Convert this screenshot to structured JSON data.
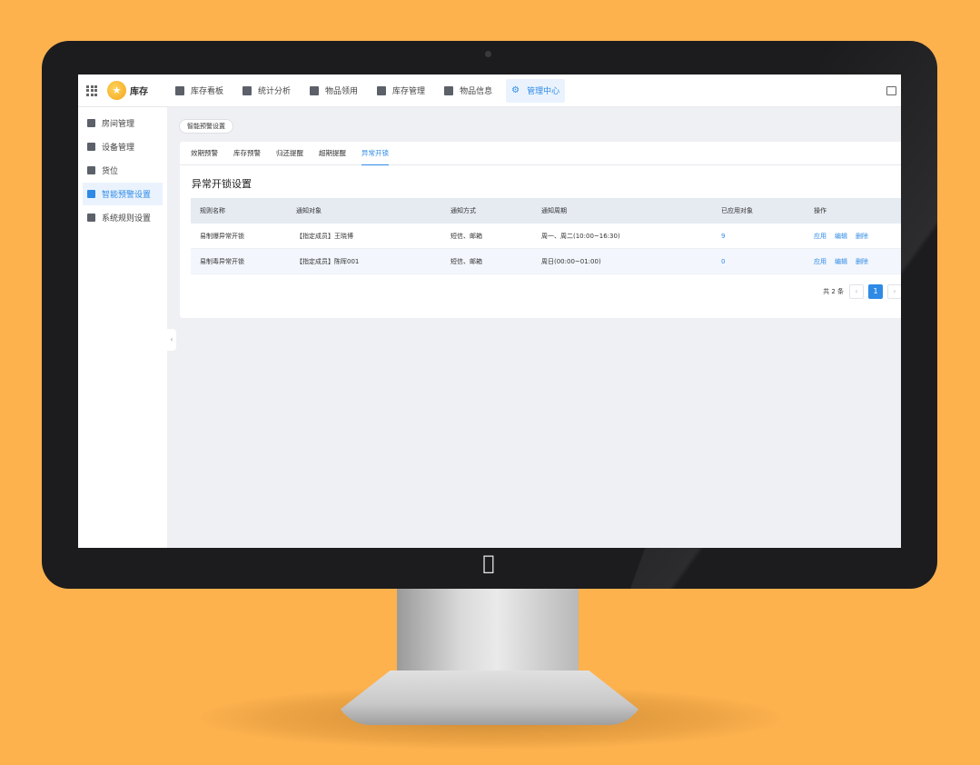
{
  "app": {
    "logo_text": "库存"
  },
  "nav": [
    {
      "label": "库存看板",
      "icon": "dashboard-icon"
    },
    {
      "label": "统计分析",
      "icon": "chart-icon"
    },
    {
      "label": "物品领用",
      "icon": "requisition-icon"
    },
    {
      "label": "库存管理",
      "icon": "inventory-icon"
    },
    {
      "label": "物品信息",
      "icon": "item-info-icon"
    },
    {
      "label": "管理中心",
      "icon": "gear-icon",
      "active": true
    }
  ],
  "sidebar": [
    {
      "label": "房间管理",
      "icon": "room-icon"
    },
    {
      "label": "设备管理",
      "icon": "device-icon"
    },
    {
      "label": "货位",
      "icon": "shelf-icon"
    },
    {
      "label": "智能预警设置",
      "icon": "alert-settings-icon",
      "active": true
    },
    {
      "label": "系统规则设置",
      "icon": "rules-icon"
    }
  ],
  "breadcrumb": {
    "tag": "智能预警设置"
  },
  "tabs": [
    {
      "label": "效期预警"
    },
    {
      "label": "库存预警"
    },
    {
      "label": "归还提醒"
    },
    {
      "label": "超期提醒"
    },
    {
      "label": "异常开锁",
      "active": true
    }
  ],
  "section": {
    "title": "异常开锁设置"
  },
  "table": {
    "headers": [
      "规则名称",
      "通知对象",
      "通知方式",
      "通知周期",
      "已应用对象",
      "操作"
    ],
    "rows": [
      {
        "name": "易制爆异常开锁",
        "target": "【指定成员】王晓博",
        "method": "短信、邮箱",
        "period": "周一、周二(10:00~16:30)",
        "applied": "9"
      },
      {
        "name": "易制毒异常开锁",
        "target": "【指定成员】陈晖001",
        "method": "短信、邮箱",
        "period": "周日(00:00~01:00)",
        "applied": "0"
      }
    ],
    "actions": {
      "apply": "应用",
      "edit": "编辑",
      "delete": "删除"
    }
  },
  "pagination": {
    "total": "共 2 条",
    "prev": "‹",
    "current": "1",
    "next": "›"
  },
  "colors": {
    "accent": "#2f8ae6",
    "background": "#FDB24E",
    "bezel": "#1c1c1e"
  }
}
